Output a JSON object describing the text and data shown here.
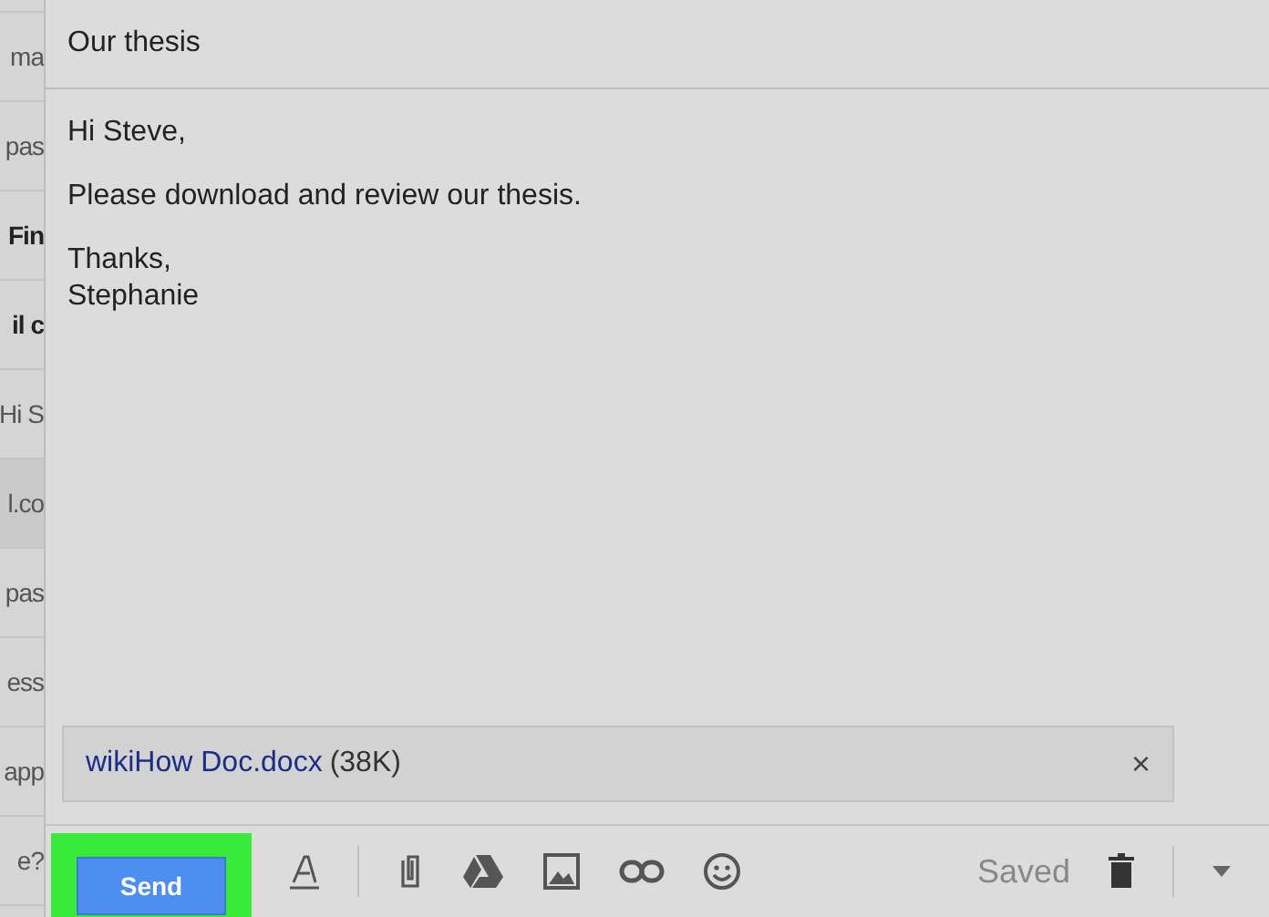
{
  "inbox_list": [
    {
      "snippet": "ma",
      "unread": false,
      "selected": false
    },
    {
      "snippet": "pas",
      "unread": false,
      "selected": false
    },
    {
      "snippet": "Fin",
      "unread": true,
      "selected": false
    },
    {
      "snippet": "il c",
      "unread": true,
      "selected": false
    },
    {
      "snippet": "Hi S",
      "unread": false,
      "selected": false
    },
    {
      "snippet": "l.co",
      "unread": false,
      "selected": true
    },
    {
      "snippet": "pas",
      "unread": false,
      "selected": false
    },
    {
      "snippet": "ess",
      "unread": false,
      "selected": false
    },
    {
      "snippet": "app",
      "unread": false,
      "selected": false
    },
    {
      "snippet": "e?",
      "unread": false,
      "selected": false
    }
  ],
  "compose": {
    "subject": "Our thesis",
    "body": [
      "Hi Steve,",
      "Please download and review our thesis.",
      "Thanks,\nStephanie"
    ],
    "attachment": {
      "name": "wikiHow Doc.docx",
      "size": "(38K)",
      "remove": "×"
    },
    "send_button": {
      "label": "Send",
      "highlighted": true
    },
    "status": "Saved"
  }
}
